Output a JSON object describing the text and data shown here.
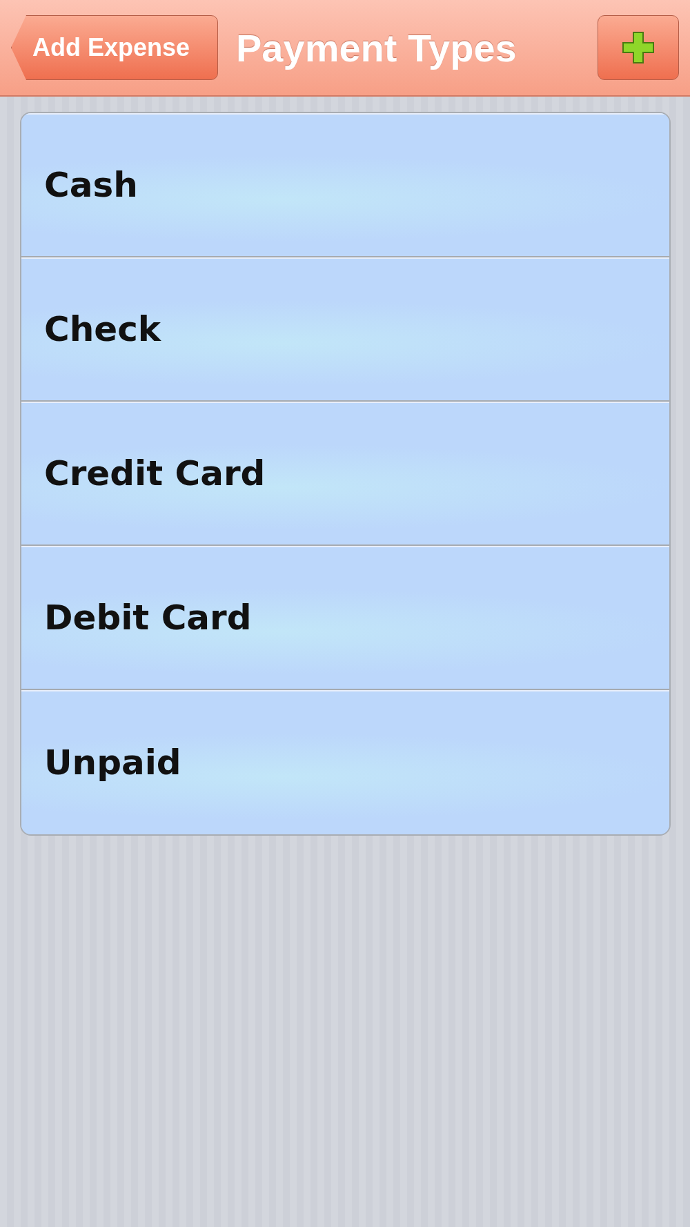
{
  "nav_bar": {
    "back_button": "Add Expense",
    "title": "Payment Types"
  },
  "payment_types": [
    {
      "label": "Cash"
    },
    {
      "label": "Check"
    },
    {
      "label": "Credit Card"
    },
    {
      "label": "Debit Card"
    },
    {
      "label": "Unpaid"
    }
  ]
}
